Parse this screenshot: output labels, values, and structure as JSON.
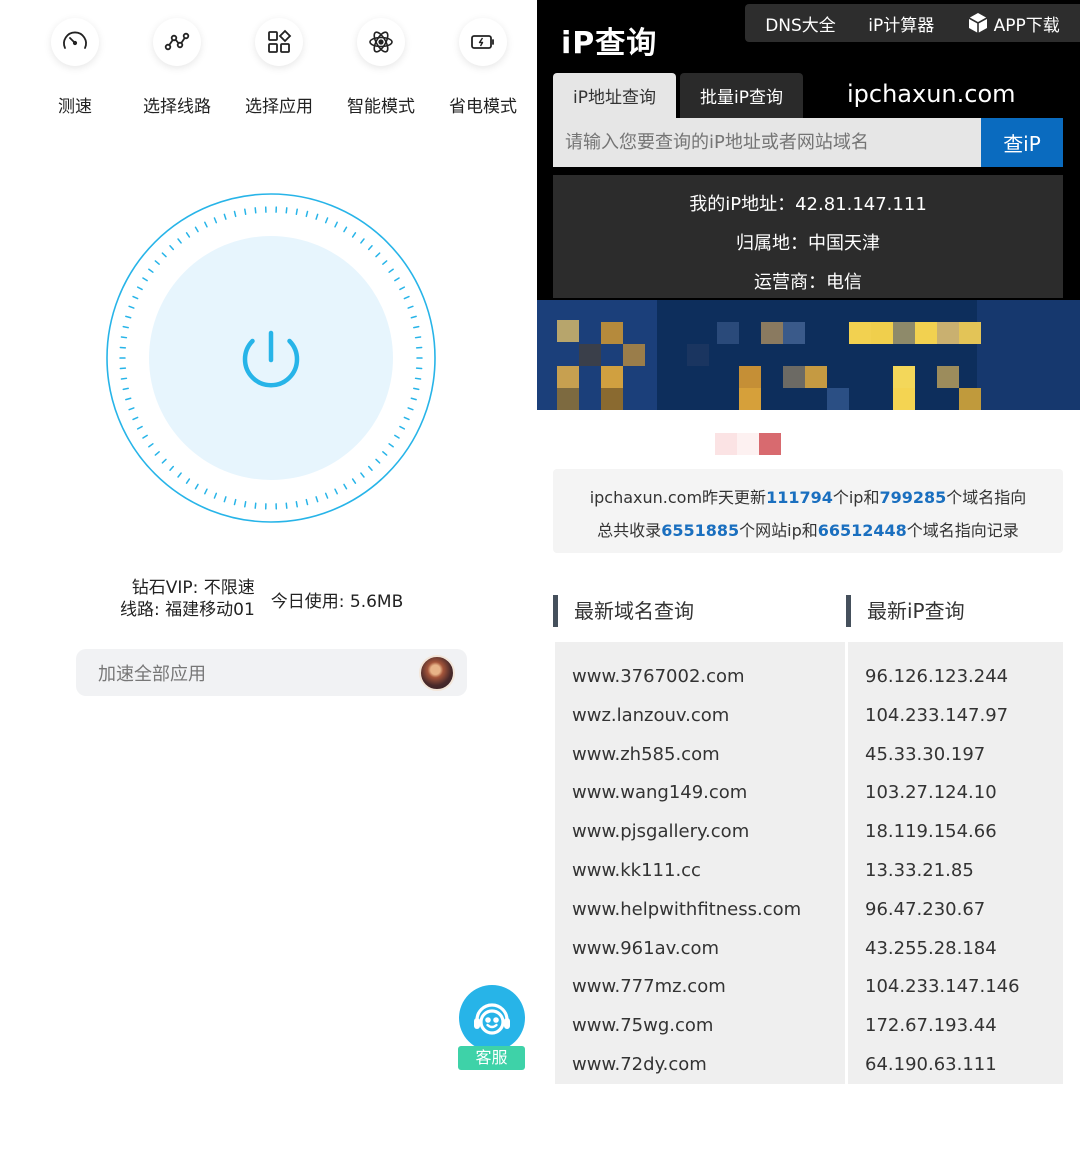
{
  "left": {
    "top_icons": [
      {
        "icon": "speedometer-icon",
        "label": "测速"
      },
      {
        "icon": "route-icon",
        "label": "选择线路"
      },
      {
        "icon": "apps-icon",
        "label": "选择应用"
      },
      {
        "icon": "atom-icon",
        "label": "智能模式"
      },
      {
        "icon": "battery-icon",
        "label": "省电模式"
      }
    ],
    "power_icon": "power-icon",
    "status": {
      "vip": "钻石VIP: 不限速",
      "line": "线路: 福建移动01",
      "usage": "今日使用: 5.6MB"
    },
    "accelerate_all": "加速全部应用",
    "customer_service": "客服",
    "colors": {
      "accent": "#27b4e8",
      "dial_fill": "#e7f5fd",
      "service_label": "#3ed2a8"
    }
  },
  "right": {
    "logo": "iP查询",
    "top_nav": [
      "DNS大全",
      "iP计算器",
      "APP下载"
    ],
    "tabs": [
      "iP地址查询",
      "批量iP查询"
    ],
    "site_domain": "ipchaxun.com",
    "search": {
      "placeholder": "请输入您要查询的iP地址或者网站域名",
      "button": "查iP"
    },
    "ip_info": {
      "my_ip_label": "我的iP地址：",
      "my_ip": "42.81.147.111",
      "location_label": "归属地：",
      "location": "中国天津",
      "isp_label": "运营商：",
      "isp": "电信"
    },
    "stats": {
      "line1_prefix": "ipchaxun.com昨天更新",
      "updated_ips": "111794",
      "line1_mid": "个ip和",
      "updated_domains": "799285",
      "line1_suffix": "个域名指向",
      "line2_prefix": "总共收录",
      "total_sites": "6551885",
      "line2_mid": "个网站ip和",
      "total_records": "66512448",
      "line2_suffix": "个域名指向记录"
    },
    "latest_domains_title": "最新域名查询",
    "latest_ips_title": "最新iP查询",
    "latest_domains": [
      "www.3767002.com",
      "wwz.lanzouv.com",
      "www.zh585.com",
      "www.wang149.com",
      "www.pjsgallery.com",
      "www.kk111.cc",
      "www.helpwithfitness.com",
      "www.961av.com",
      "www.777mz.com",
      "www.75wg.com",
      "www.72dy.com"
    ],
    "latest_ips": [
      "96.126.123.244",
      "104.233.147.97",
      "45.33.30.197",
      "103.27.124.10",
      "18.119.154.66",
      "13.33.21.85",
      "96.47.230.67",
      "43.255.28.184",
      "104.233.147.146",
      "172.67.193.44",
      "64.190.63.111"
    ],
    "colors": {
      "button_blue": "#0a6bbf",
      "number_blue": "#1a6fbf",
      "header_black": "#000000"
    }
  }
}
